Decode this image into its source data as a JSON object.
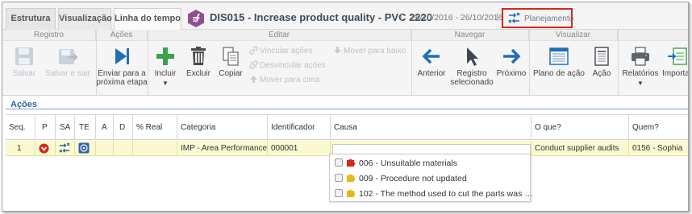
{
  "tabs": [
    {
      "label": "Estrutura"
    },
    {
      "label": "Visualização"
    },
    {
      "label": "Linha do tempo"
    }
  ],
  "record": {
    "title": "DIS015 - Increase product quality - PVC 2220",
    "separator": "|",
    "dates": "26/10/2016 - 26/10/2016",
    "planning_label": "Planejamento"
  },
  "ribbon": {
    "groups": {
      "registro": "Registro",
      "acoes": "Ações",
      "editar": "Editar",
      "navegar": "Navegar",
      "visualizar": "Visualizar"
    },
    "buttons": {
      "salvar": "Salvar",
      "salvar_sair": "Salvar e sair",
      "enviar_1": "Enviar para a",
      "enviar_2": "próxima etapa",
      "incluir": "Incluir",
      "excluir": "Excluir",
      "copiar": "Copiar",
      "vincular": "Vincular ações",
      "desvincular": "Desvincular ações",
      "mover_cima": "Mover para cima",
      "mover_baixo": "Mover para baixo",
      "anterior": "Anterior",
      "registro_sel_1": "Registro",
      "registro_sel_2": "selecionado",
      "proximo": "Próximo",
      "plano": "Plano de ação",
      "acao": "Ação",
      "relatorios": "Relatórios",
      "importar": "Importa"
    }
  },
  "section": {
    "title": "Ações"
  },
  "grid": {
    "columns": [
      "Seq.",
      "P",
      "SA",
      "TE",
      "A",
      "D",
      "% Real",
      "Categoria",
      "Identificador",
      "Causa",
      "O que?",
      "Quem?"
    ],
    "rows": [
      {
        "seq": "1",
        "categoria": "IMP - Area Performance…",
        "identificador": "000001",
        "causa": "",
        "o_que": "Conduct supplier audits",
        "quem": "0156 - Sophia"
      }
    ]
  },
  "cause_options": [
    {
      "label": "006 - Unsuitable materials",
      "icon": "red-puzzle-icon"
    },
    {
      "label": "009 - Procedure not updated",
      "icon": "yellow-puzzle-icon"
    },
    {
      "label": "102 - The method used to cut the parts was …",
      "icon": "yellow-puzzle-icon"
    }
  ],
  "colors": {
    "accent": "#2f63a8",
    "highlight_border": "#d9261c",
    "row_highlight": "#fbf9cf",
    "priority_red": "#d9261c"
  }
}
